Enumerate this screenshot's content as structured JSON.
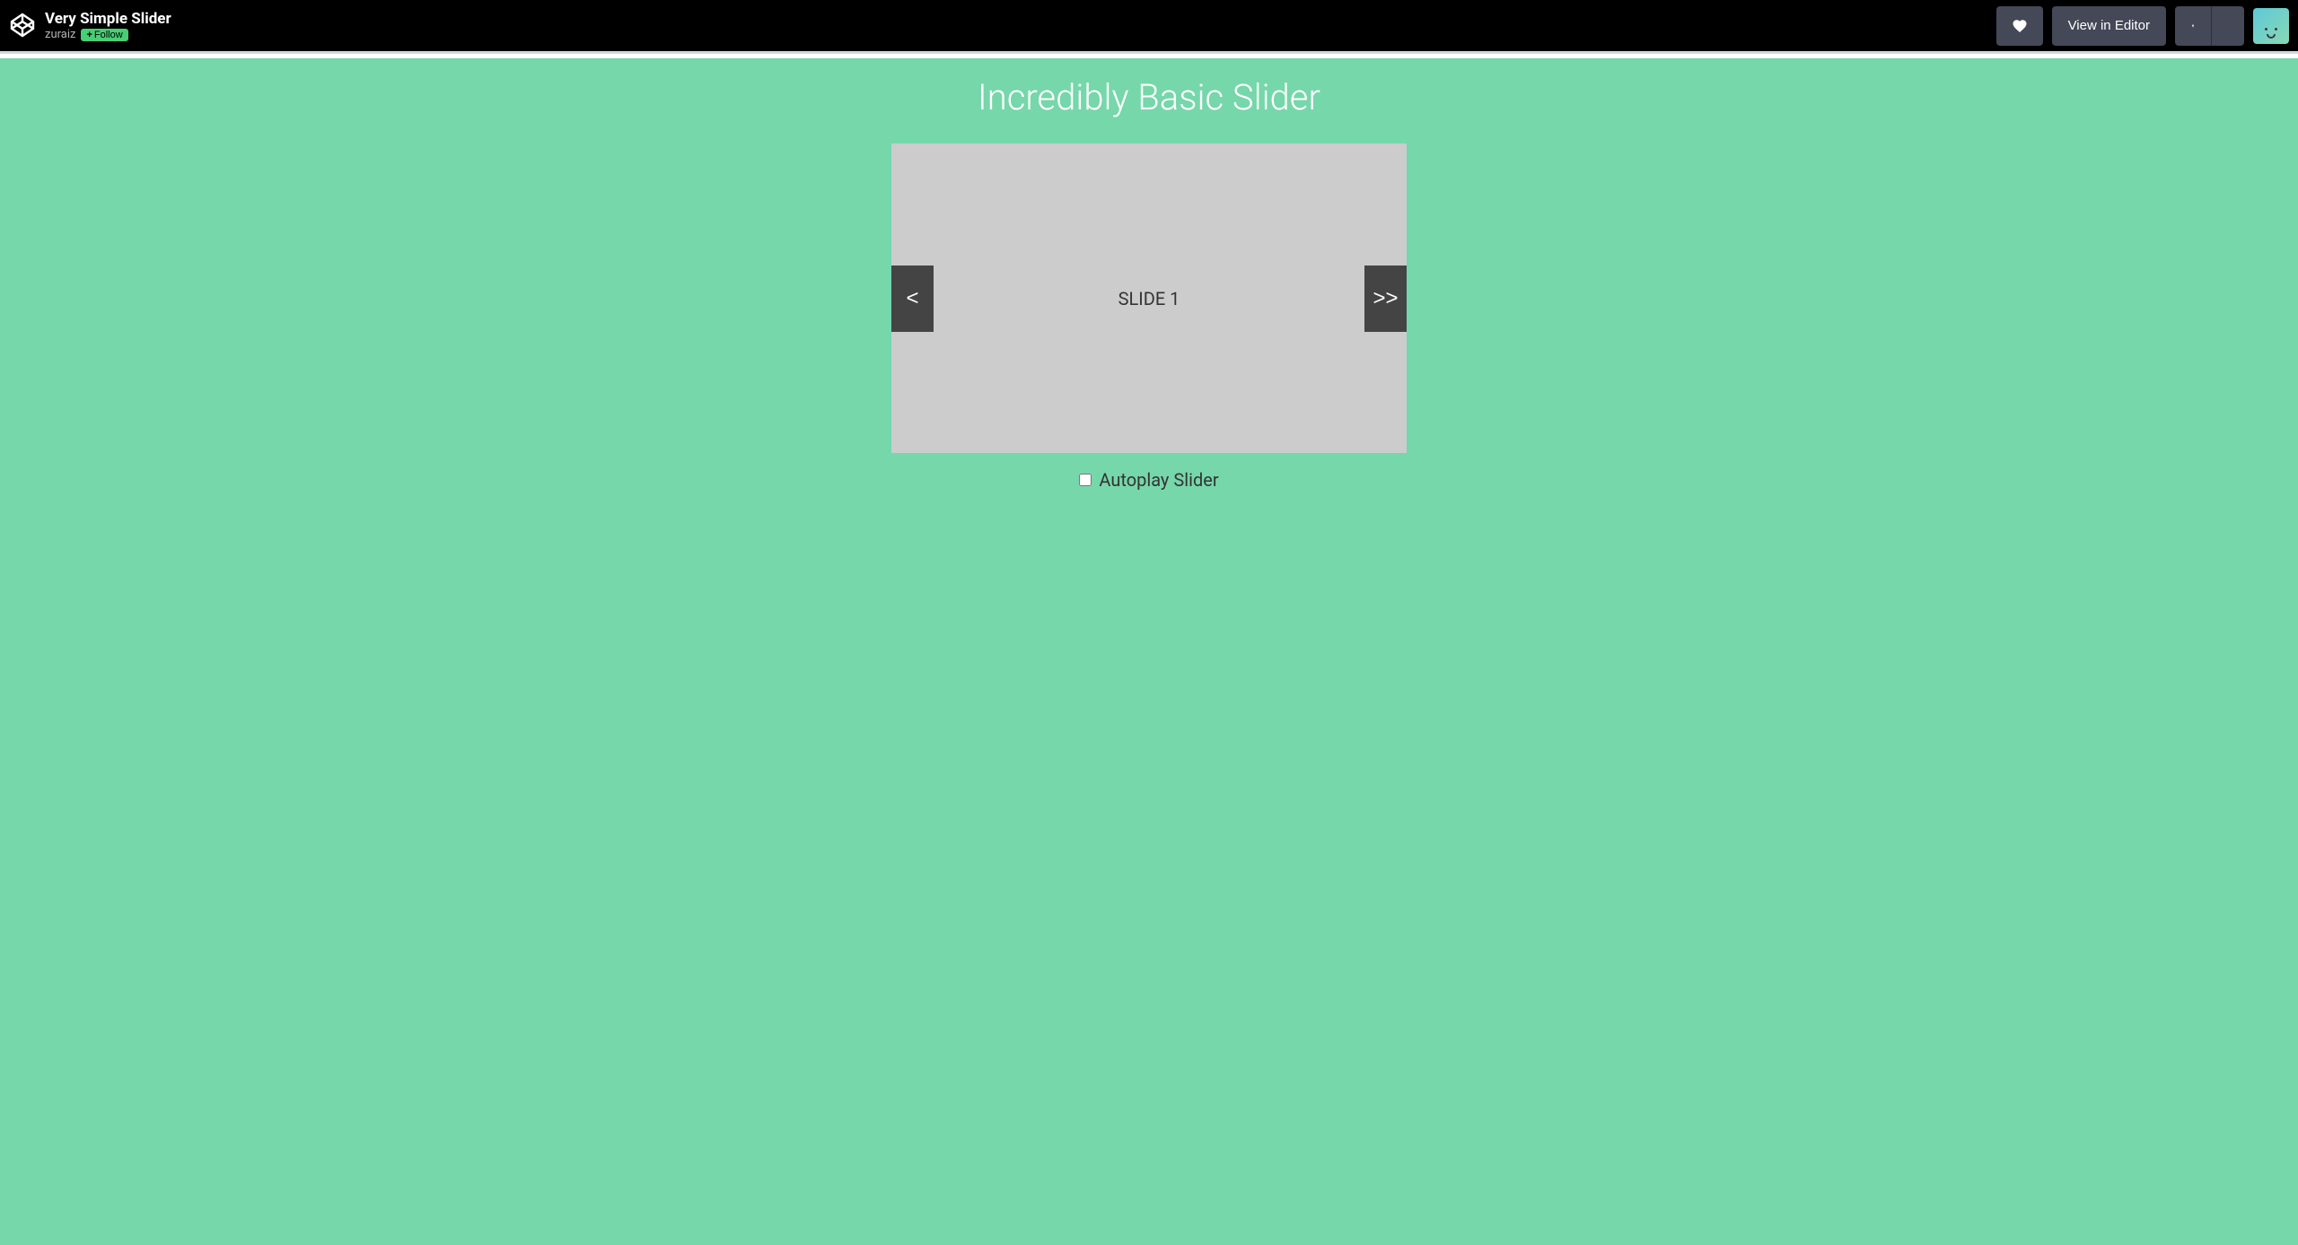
{
  "header": {
    "pen_title": "Very Simple Slider",
    "author": "zuraiz",
    "follow_label": "Follow",
    "view_editor_label": "View in Editor"
  },
  "content": {
    "title": "Incredibly Basic Slider",
    "slide_label": "SLIDE 1",
    "prev_label": "<",
    "next_label": ">>",
    "autoplay_label": "Autoplay Slider"
  },
  "colors": {
    "content_bg": "#76d7aa",
    "slider_bg": "#ccc",
    "nav_bg": "#444",
    "header_btn_bg": "#444857",
    "follow_bg": "#47cf73"
  }
}
